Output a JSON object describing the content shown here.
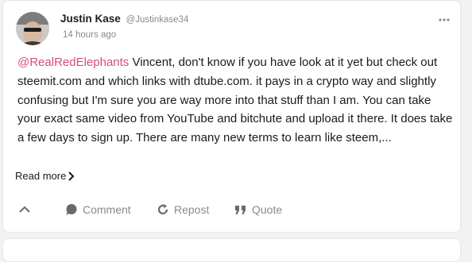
{
  "post": {
    "author_name": "Justin Kase",
    "author_handle": "@Justinkase34",
    "time": "14 hours ago",
    "mention": "@RealRedElephants",
    "body": " Vincent, don't know if you have look at it yet but check out steemit.com and which links with dtube.com.  it pays in a crypto way and slightly confusing but I'm sure you are way more into that stuff than I am.  You can take your exact same video from YouTube and bitchute and upload it there.  It does take a few days to sign up.  There are many new terms to learn like steem,...",
    "read_more": "Read more"
  },
  "actions": {
    "comment": "Comment",
    "repost": "Repost",
    "quote": "Quote"
  },
  "icons": {
    "more": "more-horizontal-icon",
    "read_more": "chevron-right-icon",
    "collapse": "chevron-up-icon",
    "comment": "comment-bubble-icon",
    "repost": "repost-icon",
    "quote": "quote-icon"
  },
  "colors": {
    "mention": "#d94c7a",
    "muted": "#8a8a8a"
  }
}
